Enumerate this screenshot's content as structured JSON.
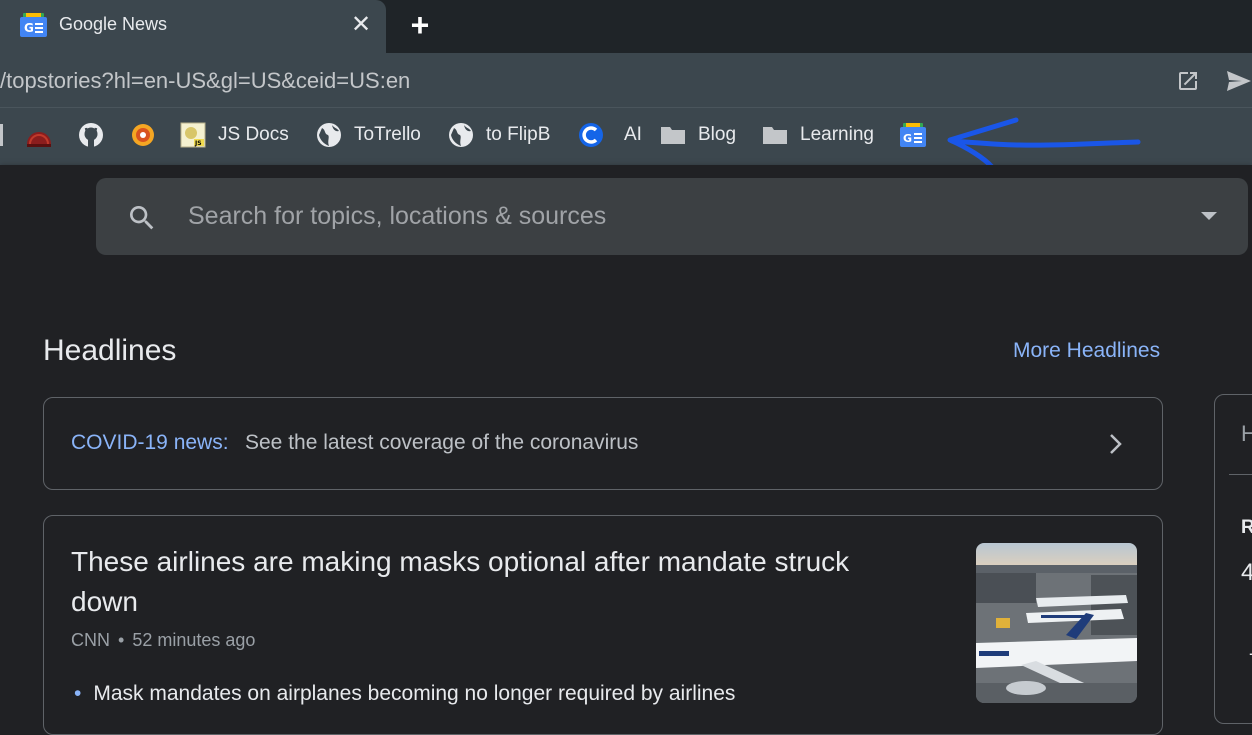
{
  "browser": {
    "tab_title": "Google News",
    "url": "/topstories?hl=en-US&gl=US&ceid=US:en"
  },
  "bookmarks": [
    {
      "label": "",
      "icon": "red-dome-icon"
    },
    {
      "label": "",
      "icon": "github-icon"
    },
    {
      "label": "",
      "icon": "orange-badge-icon"
    },
    {
      "label": "JS Docs",
      "icon": "js-docs-icon"
    },
    {
      "label": "ToTrello",
      "icon": "globe-icon"
    },
    {
      "label": "to FlipB",
      "icon": "globe-icon"
    },
    {
      "label": "AI",
      "icon": "c-logo-icon"
    },
    {
      "label": "Blog",
      "icon": "folder-icon"
    },
    {
      "label": "Learning",
      "icon": "folder-icon"
    },
    {
      "label": "",
      "icon": "google-news-icon"
    }
  ],
  "search": {
    "placeholder": "Search for topics, locations & sources"
  },
  "headlines": {
    "title": "Headlines",
    "more_link": "More Headlines"
  },
  "covid": {
    "label": "COVID-19 news:",
    "text": "See the latest coverage of the coronavirus"
  },
  "story": {
    "title": "These airlines are making masks optional after mandate struck down",
    "source": "CNN",
    "separator": "•",
    "time": "52 minutes ago",
    "bullet": "Mask mandates on airplanes becoming no longer required by airlines"
  },
  "side_panel": {
    "letter1": "H",
    "letter2": "R",
    "letter3": "4",
    "letter4": "-"
  },
  "colors": {
    "accent_link": "#8ab4f8",
    "annotation_arrow": "#1a56e8"
  }
}
